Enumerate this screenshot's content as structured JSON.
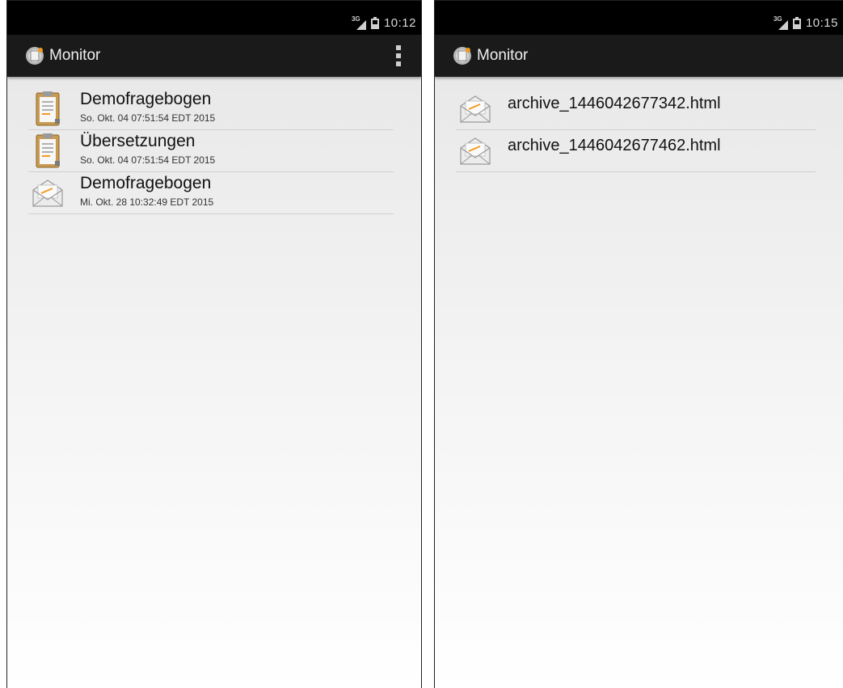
{
  "left_screen": {
    "status": {
      "time": "10:12",
      "network": "3G"
    },
    "app_title": "Monitor",
    "items": [
      {
        "title": "Demofragebogen",
        "subtitle": "So. Okt. 04 07:51:54 EDT 2015",
        "icon": "clipboard-icon"
      },
      {
        "title": "Übersetzungen",
        "subtitle": "So. Okt. 04 07:51:54 EDT 2015",
        "icon": "clipboard-icon"
      },
      {
        "title": "Demofragebogen",
        "subtitle": "Mi. Okt. 28 10:32:49 EDT 2015",
        "icon": "envelope-icon"
      }
    ]
  },
  "right_screen": {
    "status": {
      "time": "10:15",
      "network": "3G"
    },
    "app_title": "Monitor",
    "items": [
      {
        "title": "archive_1446042677342.html",
        "icon": "envelope-icon"
      },
      {
        "title": "archive_1446042677462.html",
        "icon": "envelope-icon"
      }
    ]
  },
  "colors": {
    "statusbar": "#000000",
    "actionbar": "#1a1a1a",
    "clipboard_board": "#c89a52",
    "envelope_accent": "#f39a1e"
  }
}
